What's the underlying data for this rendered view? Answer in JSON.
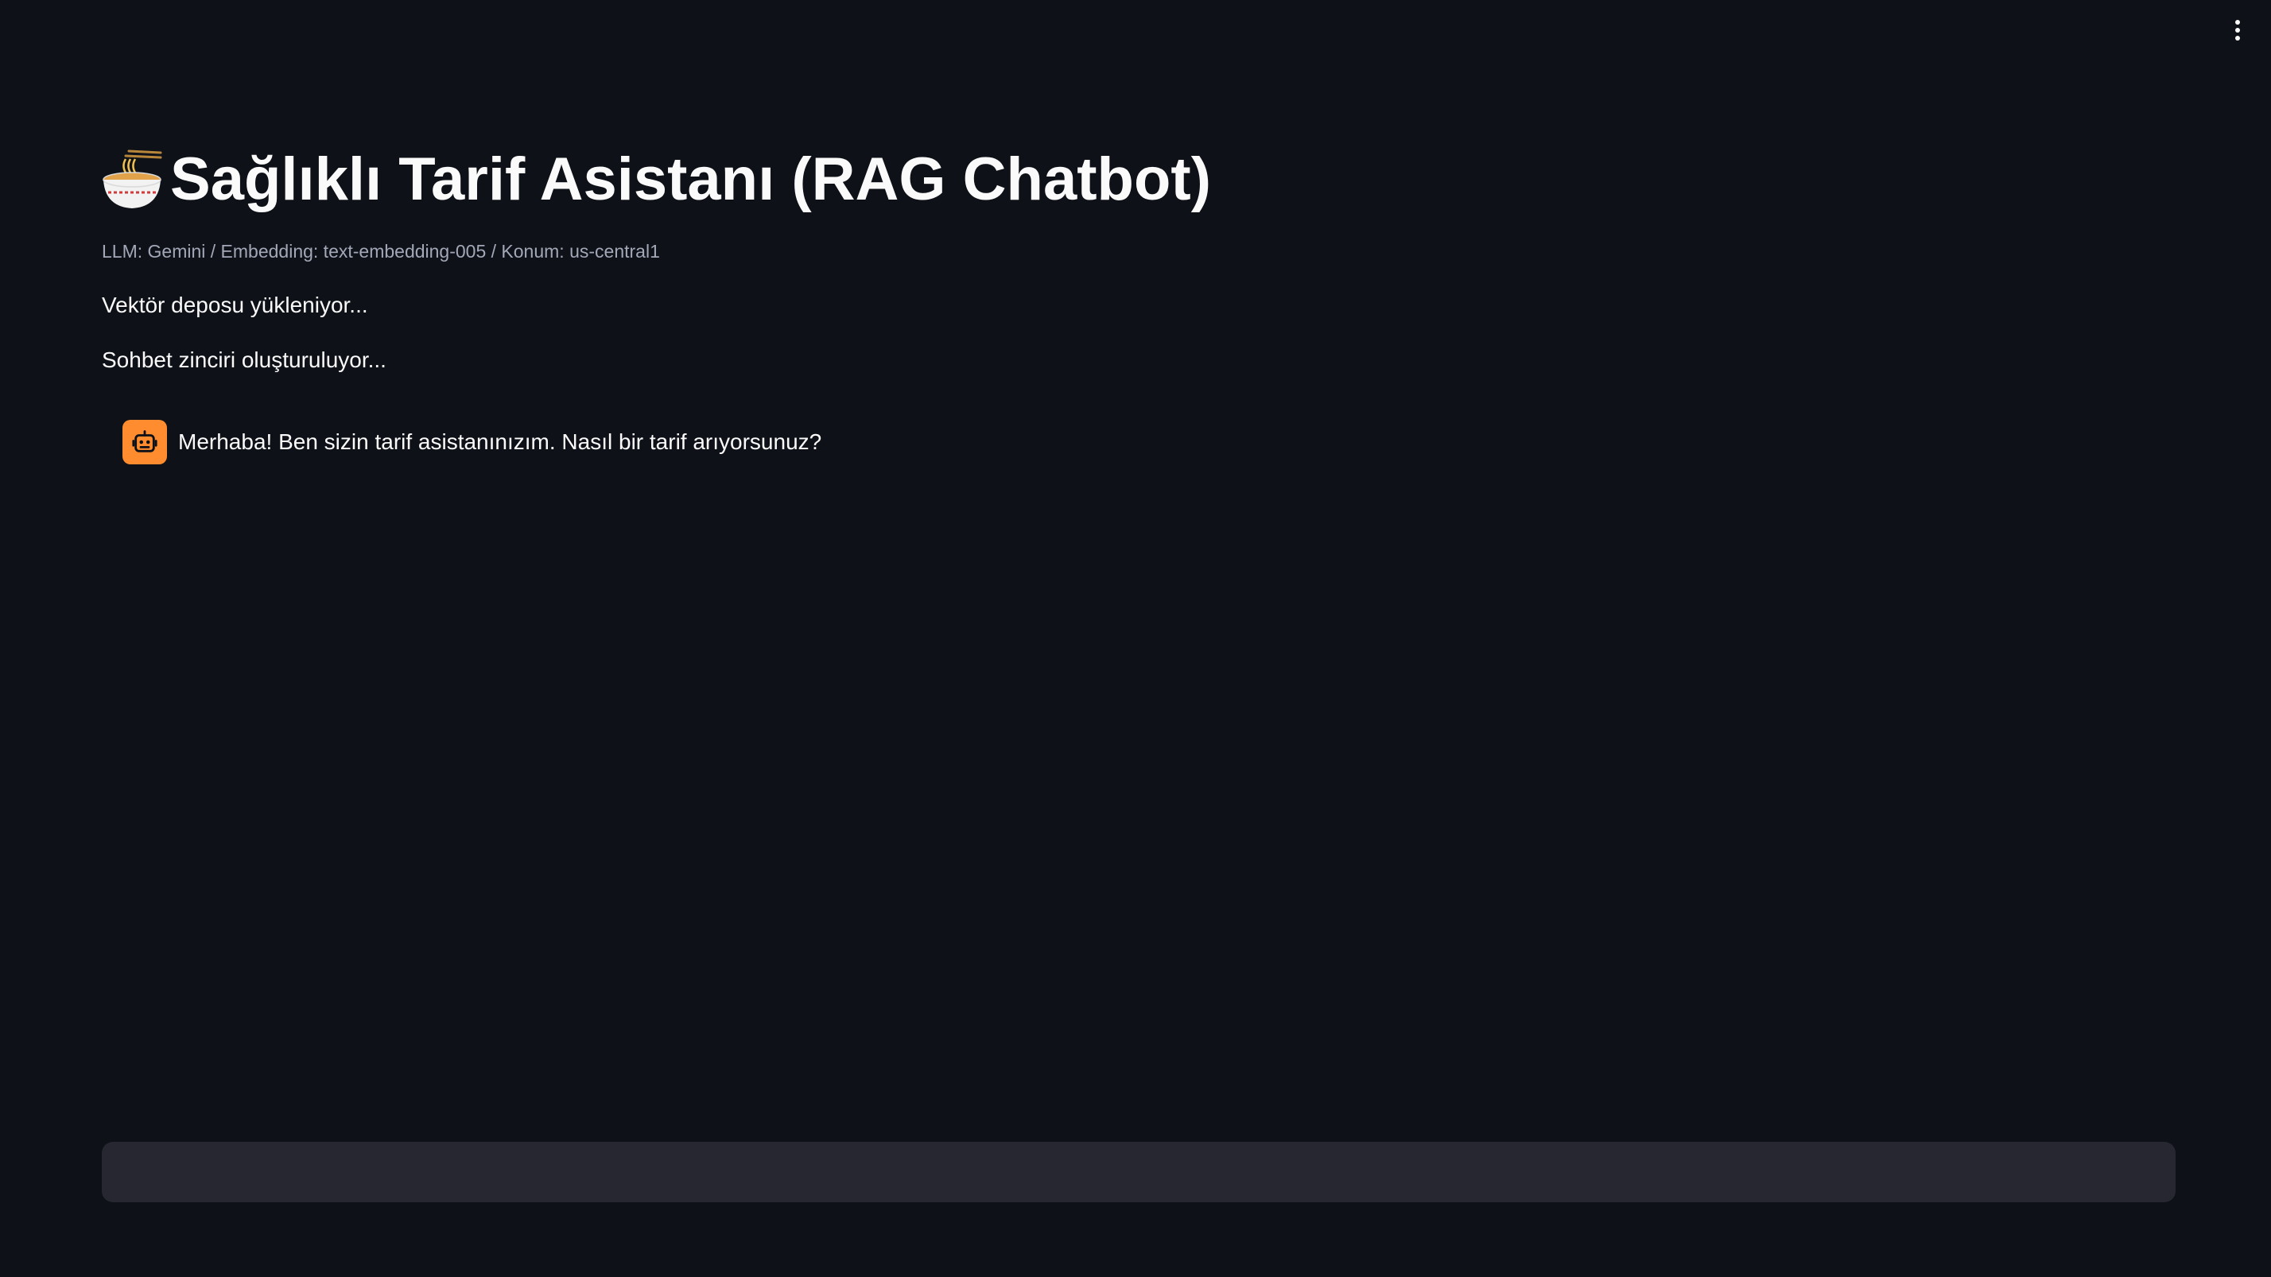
{
  "header": {
    "menu_icon": "vertical-ellipsis-icon"
  },
  "page": {
    "title_icon": "steaming-bowl-icon",
    "title": "Sağlıklı Tarif Asistanı (RAG Chatbot)",
    "caption": "LLM: Gemini / Embedding: text-embedding-005 / Konum: us-central1"
  },
  "status": {
    "loading_vector_store": "Vektör deposu yükleniyor...",
    "building_chain": "Sohbet zinciri oluşturuluyor..."
  },
  "chat": {
    "messages": [
      {
        "role": "assistant",
        "avatar_icon": "robot-icon",
        "avatar_color": "#ff8c2e",
        "text": "Merhaba! Ben sizin tarif asistanınızım. Nasıl bir tarif arıyorsunuz?"
      }
    ],
    "input": {
      "value": "",
      "placeholder": ""
    }
  },
  "colors": {
    "background": "#0e1117",
    "text": "#fafafa",
    "caption": "#a3a8b8",
    "input_background": "#262730",
    "accent": "#ff8c2e"
  }
}
